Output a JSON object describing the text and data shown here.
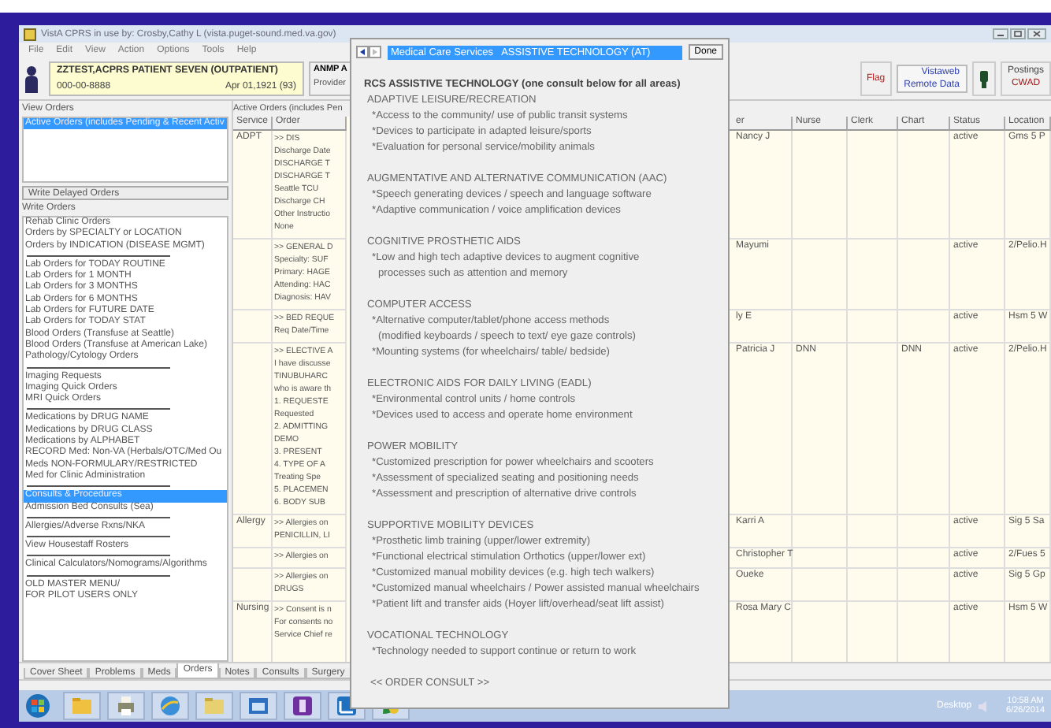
{
  "window": {
    "title": "VistA CPRS in use by: Crosby,Cathy L (vista.puget-sound.med.va.gov)"
  },
  "menu": [
    "File",
    "Edit",
    "View",
    "Action",
    "Options",
    "Tools",
    "Help"
  ],
  "patient": {
    "name": "ZZTEST,ACPRS PATIENT SEVEN (OUTPATIENT)",
    "ssn": "000-00-8888",
    "dob": "Apr 01,1921 (93)",
    "team": "ANMP A",
    "provider": "Provider"
  },
  "flag": "Flag",
  "remote": [
    "Vistaweb",
    "Remote Data"
  ],
  "postings": {
    "label": "Postings",
    "value": "CWAD"
  },
  "view_orders": {
    "label": "View Orders",
    "items": [
      {
        "text": "Active Orders (includes Pending & Recent Activ",
        "selected": true
      }
    ]
  },
  "write_delayed": "Write Delayed Orders",
  "write_orders": {
    "label": "Write Orders",
    "items": [
      {
        "kind": "item",
        "text": "Rehab Clinic Orders",
        "selected": false
      },
      {
        "kind": "item",
        "text": "Orders by SPECIALTY or LOCATION",
        "selected": false
      },
      {
        "kind": "item",
        "text": "Orders by INDICATION (DISEASE MGMT)",
        "selected": false
      },
      {
        "kind": "separator"
      },
      {
        "kind": "item",
        "text": "Lab Orders for TODAY ROUTINE",
        "selected": false
      },
      {
        "kind": "item",
        "text": "Lab Orders for 1 MONTH",
        "selected": false
      },
      {
        "kind": "item",
        "text": "Lab Orders for 3 MONTHS",
        "selected": false
      },
      {
        "kind": "item",
        "text": "Lab Orders for 6 MONTHS",
        "selected": false
      },
      {
        "kind": "item",
        "text": "Lab Orders for FUTURE DATE",
        "selected": false
      },
      {
        "kind": "item",
        "text": "Lab Orders for TODAY STAT",
        "selected": false
      },
      {
        "kind": "item",
        "text": "Blood Orders (Transfuse at Seattle)",
        "selected": false
      },
      {
        "kind": "item",
        "text": "Blood Orders (Transfuse at American Lake)",
        "selected": false
      },
      {
        "kind": "item",
        "text": "Pathology/Cytology Orders",
        "selected": false
      },
      {
        "kind": "separator"
      },
      {
        "kind": "item",
        "text": "Imaging Requests",
        "selected": false
      },
      {
        "kind": "item",
        "text": "Imaging Quick Orders",
        "selected": false
      },
      {
        "kind": "item",
        "text": "MRI Quick Orders",
        "selected": false
      },
      {
        "kind": "separator"
      },
      {
        "kind": "item",
        "text": "Medications by DRUG NAME",
        "selected": false
      },
      {
        "kind": "item",
        "text": "Medications by DRUG CLASS",
        "selected": false
      },
      {
        "kind": "item",
        "text": "Medications by ALPHABET",
        "selected": false
      },
      {
        "kind": "item",
        "text": "RECORD Med: Non-VA (Herbals/OTC/Med Ou",
        "selected": false
      },
      {
        "kind": "item",
        "text": "Meds NON-FORMULARY/RESTRICTED",
        "selected": false
      },
      {
        "kind": "item",
        "text": "Med for Clinic Administration",
        "selected": false
      },
      {
        "kind": "separator"
      },
      {
        "kind": "item",
        "text": "Consults & Procedures",
        "selected": true
      },
      {
        "kind": "item",
        "text": "Admission Bed Consults (Sea)",
        "selected": false
      },
      {
        "kind": "separator"
      },
      {
        "kind": "item",
        "text": "Allergies/Adverse Rxns/NKA",
        "selected": false
      },
      {
        "kind": "separator"
      },
      {
        "kind": "item",
        "text": "View Housestaff Rosters",
        "selected": false
      },
      {
        "kind": "separator"
      },
      {
        "kind": "item",
        "text": "Clinical Calculators/Nomograms/Algorithms",
        "selected": false
      },
      {
        "kind": "separator"
      },
      {
        "kind": "item",
        "text": "OLD MASTER MENU/",
        "selected": false
      },
      {
        "kind": "item",
        "text": "FOR PILOT USERS ONLY",
        "selected": false
      }
    ]
  },
  "orders": {
    "title": "Active Orders (includes Pen",
    "columns": [
      "Service",
      "Order",
      "er",
      "Nurse",
      "Clerk",
      "Chart",
      "Status",
      "Location"
    ],
    "rows": [
      {
        "service": "ADPT",
        "order": [
          ">> DIS",
          "Discharge Date",
          "DISCHARGE T",
          "DISCHARGE T",
          "Seattle TCU",
          "Discharge CH",
          "Other Instructio",
          "None"
        ],
        "provider": "Nancy J",
        "status": "active",
        "location": "Gms 5 P"
      },
      {
        "order": [
          ">> GENERAL D",
          "Specialty: SUF",
          "Primary: HAGE",
          "Attending: HAC",
          "Diagnosis: HAV"
        ],
        "provider": "Mayumi",
        "status": "active",
        "location": "2/Pelio.H"
      },
      {
        "order": [
          ">> BED REQUE",
          "Req Date/Time"
        ],
        "provider": "ly E",
        "status": "active",
        "location": "Hsm 5 W"
      },
      {
        "order": [
          ">> ELECTIVE A",
          "I have discusse",
          "TINUBUHARC",
          "who is aware th",
          "1. REQUESTE",
          "Requested",
          "2. ADMITTING",
          "DEMO",
          "3. PRESENT",
          "4. TYPE OF A",
          "Treating Spe",
          "5. PLACEMEN",
          "6. BODY SUB"
        ],
        "provider": "Patricia J",
        "nurse": "DNN",
        "chart": "DNN",
        "status": "active",
        "location": "2/Pelio.H"
      },
      {
        "service": "Allergy",
        "order": [
          ">> Allergies on",
          "PENICILLIN, LI"
        ],
        "provider": "Karri A",
        "status": "active",
        "location": "Sig 5 Sa"
      },
      {
        "order": [
          ">> Allergies on"
        ],
        "provider": "Christopher T",
        "status": "active",
        "location": "2/Fues 5"
      },
      {
        "order": [
          ">> Allergies on",
          "DRUGS"
        ],
        "provider": "Oueke",
        "status": "active",
        "location": "Sig 5 Gp"
      },
      {
        "service": "Nursing",
        "order": [
          ">> Consent is n",
          "For consents no",
          "Service Chief re"
        ],
        "provider": "Rosa Mary C",
        "status": "active",
        "location": "Hsm 5 W"
      }
    ]
  },
  "tabs": [
    {
      "label": "Cover Sheet",
      "selected": false
    },
    {
      "label": "Problems",
      "selected": false
    },
    {
      "label": "Meds",
      "selected": false
    },
    {
      "label": "Orders",
      "selected": true
    },
    {
      "label": "Notes",
      "selected": false
    },
    {
      "label": "Consults",
      "selected": false
    },
    {
      "label": "Surgery",
      "selected": false
    }
  ],
  "dialog": {
    "title": "Medical Care Services   ASSISTIVE TECHNOLOGY (AT)",
    "done": "Done",
    "heading": "RCS ASSISTIVE TECHNOLOGY (one consult below for all areas)",
    "sections": [
      {
        "title": "ADAPTIVE LEISURE/RECREATION",
        "lines": [
          {
            "kind": "bullet",
            "text": "*Access to the community/ use of public transit systems"
          },
          {
            "kind": "bullet",
            "text": "*Devices to participate in adapted leisure/sports"
          },
          {
            "kind": "bullet",
            "text": "*Evaluation for personal service/mobility animals"
          }
        ]
      },
      {
        "title": "AUGMENTATIVE AND ALTERNATIVE COMMUNICATION (AAC)",
        "lines": [
          {
            "kind": "bullet",
            "text": "*Speech generating devices / speech and language software"
          },
          {
            "kind": "bullet",
            "text": "*Adaptive communication / voice amplification devices"
          }
        ]
      },
      {
        "title": "COGNITIVE PROSTHETIC AIDS",
        "lines": [
          {
            "kind": "bullet",
            "text": "*Low and high tech adaptive devices to augment cognitive"
          },
          {
            "kind": "continuation",
            "text": "processes such as attention and memory"
          }
        ]
      },
      {
        "title": "COMPUTER ACCESS",
        "lines": [
          {
            "kind": "bullet",
            "text": "*Alternative computer/tablet/phone access methods"
          },
          {
            "kind": "continuation",
            "text": "(modified keyboards / speech to text/ eye gaze controls)"
          },
          {
            "kind": "bullet",
            "text": "*Mounting systems (for wheelchairs/ table/ bedside)"
          }
        ]
      },
      {
        "title": "ELECTRONIC AIDS FOR DAILY LIVING (EADL)",
        "lines": [
          {
            "kind": "bullet",
            "text": "*Environmental control units / home controls"
          },
          {
            "kind": "bullet",
            "text": "*Devices used to access and operate home environment"
          }
        ]
      },
      {
        "title": "POWER MOBILITY",
        "lines": [
          {
            "kind": "bullet",
            "text": "*Customized prescription for power wheelchairs and scooters"
          },
          {
            "kind": "bullet",
            "text": "*Assessment of specialized seating and positioning needs"
          },
          {
            "kind": "bullet",
            "text": "*Assessment and prescription of alternative drive controls"
          }
        ]
      },
      {
        "title": "SUPPORTIVE MOBILITY DEVICES",
        "lines": [
          {
            "kind": "bullet",
            "text": "*Prosthetic limb training (upper/lower extremity)"
          },
          {
            "kind": "bullet",
            "text": "*Functional electrical stimulation Orthotics (upper/lower ext)"
          },
          {
            "kind": "bullet",
            "text": "*Customized manual mobility devices (e.g. high tech walkers)"
          },
          {
            "kind": "bullet",
            "text": "*Customized manual wheelchairs / Power assisted manual wheelchairs"
          },
          {
            "kind": "bullet",
            "text": "*Patient lift and transfer aids (Hoyer lift/overhead/seat lift assist)"
          }
        ]
      },
      {
        "title": "VOCATIONAL TECHNOLOGY",
        "lines": [
          {
            "kind": "bullet",
            "text": "*Technology needed to support continue or return to work"
          }
        ]
      }
    ],
    "footer": "<< ORDER CONSULT >>"
  },
  "taskbar": {
    "tray": "Desktop",
    "time": "10:58 AM",
    "date": "6/26/2014"
  }
}
